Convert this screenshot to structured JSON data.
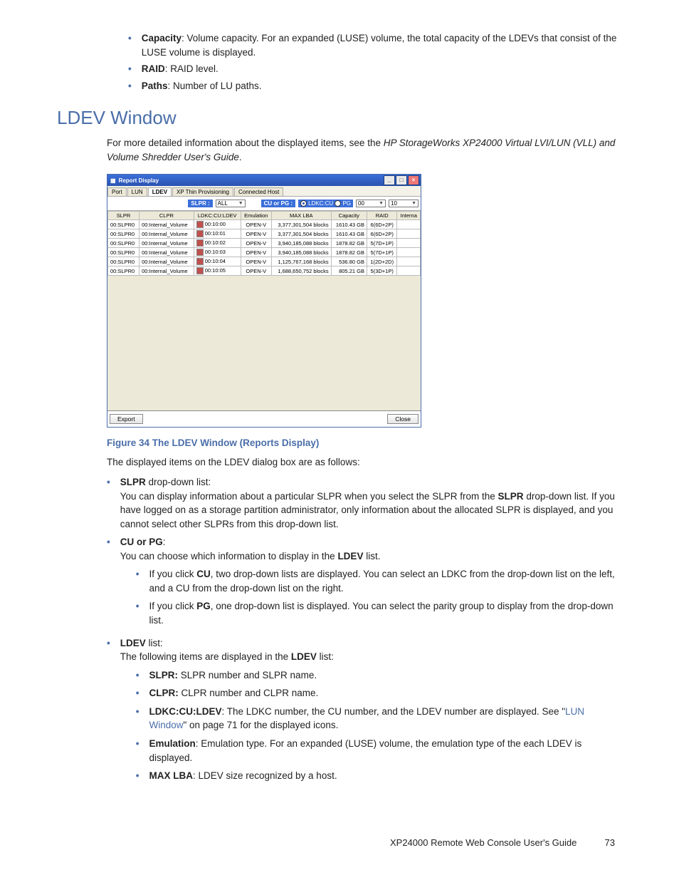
{
  "top_bullets": [
    {
      "term": "Capacity",
      "desc": ": Volume capacity. For an expanded (LUSE) volume, the total capacity of the LDEVs that consist of the LUSE volume is displayed."
    },
    {
      "term": "RAID",
      "desc": ": RAID level."
    },
    {
      "term": "Paths",
      "desc": ": Number of LU paths."
    }
  ],
  "heading": "LDEV Window",
  "intro_pre": "For more detailed information about the displayed items, see the ",
  "intro_italic": "HP StorageWorks XP24000 Virtual LVI/LUN (VLL) and Volume Shredder User's Guide",
  "intro_post": ".",
  "window": {
    "title": "Report Display",
    "tabs": [
      "Port",
      "LUN",
      "LDEV",
      "XP Thin Provisioning",
      "Connected Host"
    ],
    "active_tab": 2,
    "slpr_label": "SLPR :",
    "slpr_value": "ALL",
    "cu_or_pg_label": "CU or PG :",
    "radio_ldkc": "LDKC:CU",
    "radio_pg": "PG",
    "dd_left": "00",
    "dd_right": "10",
    "columns": [
      "SLPR",
      "CLPR",
      "LDKC:CU:LDEV",
      "Emulation",
      "MAX LBA",
      "Capacity",
      "RAID",
      "Interna"
    ],
    "rows": [
      {
        "slpr": "00:SLPR0",
        "clpr": "00:Internal_Volume",
        "ldkc": "00:10:00",
        "emu": "OPEN-V",
        "maxlba": "3,377,301,504 blocks",
        "cap": "1610.43 GB",
        "raid": "6(6D+2P)",
        "int": ""
      },
      {
        "slpr": "00:SLPR0",
        "clpr": "00:Internal_Volume",
        "ldkc": "00:10:01",
        "emu": "OPEN-V",
        "maxlba": "3,377,301,504 blocks",
        "cap": "1610.43 GB",
        "raid": "6(6D+2P)",
        "int": ""
      },
      {
        "slpr": "00:SLPR0",
        "clpr": "00:Internal_Volume",
        "ldkc": "00:10:02",
        "emu": "OPEN-V",
        "maxlba": "3,940,185,088 blocks",
        "cap": "1878.82 GB",
        "raid": "5(7D+1P)",
        "int": ""
      },
      {
        "slpr": "00:SLPR0",
        "clpr": "00:Internal_Volume",
        "ldkc": "00:10:03",
        "emu": "OPEN-V",
        "maxlba": "3,940,185,088 blocks",
        "cap": "1878.82 GB",
        "raid": "5(7D+1P)",
        "int": ""
      },
      {
        "slpr": "00:SLPR0",
        "clpr": "00:Internal_Volume",
        "ldkc": "00:10:04",
        "emu": "OPEN-V",
        "maxlba": "1,125,767,168 blocks",
        "cap": "536.80 GB",
        "raid": "1(2D+2D)",
        "int": ""
      },
      {
        "slpr": "00:SLPR0",
        "clpr": "00:Internal_Volume",
        "ldkc": "00:10:05",
        "emu": "OPEN-V",
        "maxlba": "1,688,650,752 blocks",
        "cap": "805.21 GB",
        "raid": "5(3D+1P)",
        "int": ""
      }
    ],
    "export_btn": "Export",
    "close_btn": "Close"
  },
  "caption": "Figure 34 The LDEV Window (Reports Display)",
  "para_after_caption": "The displayed items on the LDEV dialog box are as follows:",
  "items": [
    {
      "term": "SLPR",
      "term_post": " drop-down list:",
      "body_pre": "You can display information about a particular SLPR when you select the SLPR from the ",
      "body_bold": "SLPR",
      "body_post": " drop-down list. If you have logged on as a storage partition administrator, only information about the allocated SLPR is displayed, and you cannot select other SLPRs from this drop-down list.",
      "sub": []
    },
    {
      "term": "CU or PG",
      "term_post": ":",
      "body_pre": "You can choose which information to display in the ",
      "body_bold": "LDEV",
      "body_post": " list.",
      "sub": [
        {
          "pre": "If you click ",
          "b": "CU",
          "post": ", two drop-down lists are displayed. You can select an LDKC from the drop-down list on the left, and a CU from the drop-down list on the right."
        },
        {
          "pre": "If you click ",
          "b": "PG",
          "post": ", one drop-down list is displayed. You can select the parity group to display from the drop-down list."
        }
      ]
    },
    {
      "term": "LDEV",
      "term_post": " list:",
      "body_pre": "The following items are displayed in the ",
      "body_bold": "LDEV",
      "body_post": " list:",
      "sub": [
        {
          "pre": "",
          "b": "SLPR:",
          "post": " SLPR number and SLPR name."
        },
        {
          "pre": "",
          "b": "CLPR:",
          "post": " CLPR number and CLPR name."
        },
        {
          "pre": "",
          "b": "LDKC:CU:LDEV",
          "post": ": The LDKC number, the CU number, and the LDEV number are displayed. See \"",
          "link": "LUN Window",
          "post2": "\" on page 71 for the displayed icons."
        },
        {
          "pre": "",
          "b": "Emulation",
          "post": ": Emulation type. For an expanded (LUSE) volume, the emulation type of the each LDEV is displayed."
        },
        {
          "pre": "",
          "b": "MAX LBA",
          "post": ": LDEV size recognized by a host."
        }
      ]
    }
  ],
  "footer_title": "XP24000 Remote Web Console User's Guide",
  "footer_page": "73"
}
